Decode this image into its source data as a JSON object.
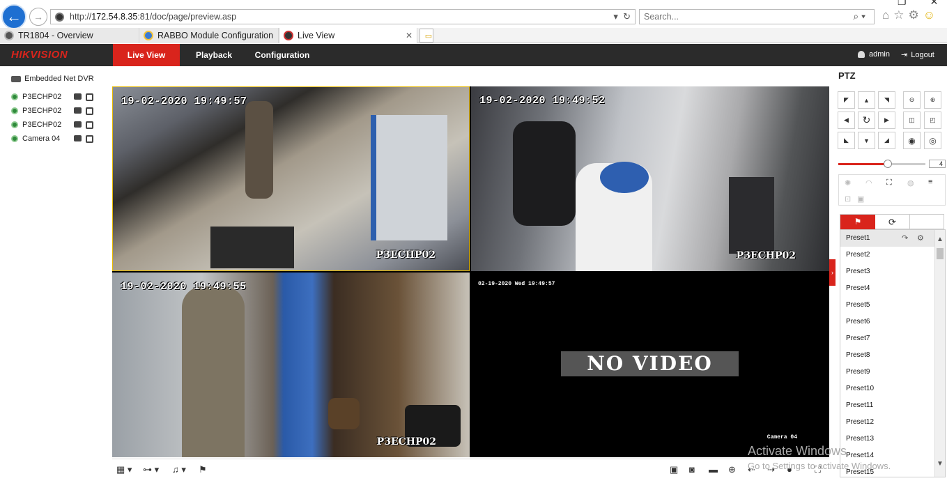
{
  "browser": {
    "url_prefix": "http://",
    "url_host": "172.54.8.35",
    "url_rest": ":81/doc/page/preview.asp",
    "search_placeholder": "Search...",
    "tabs": [
      {
        "label": "TR1804 - Overview"
      },
      {
        "label": "RABBO Module Configuration"
      },
      {
        "label": "Live View"
      }
    ]
  },
  "app": {
    "logo": "HIKVISION",
    "nav": [
      "Live View",
      "Playback",
      "Configuration"
    ],
    "user": "admin",
    "logout": "Logout"
  },
  "tree": {
    "root": "Embedded Net DVR",
    "cameras": [
      {
        "name": "P3ECHP02"
      },
      {
        "name": "P3ECHP02"
      },
      {
        "name": "P3ECHP02"
      },
      {
        "name": "Camera 04"
      }
    ]
  },
  "panes": [
    {
      "timestamp": "19-02-2020 19:49:57",
      "name": "P3ECHP02"
    },
    {
      "timestamp": "19-02-2020 19:49:52",
      "name": "P3ECHP02"
    },
    {
      "timestamp": "19-02-2020 19:49:55",
      "name": "P3ECHP02"
    },
    {
      "timestamp": "02-19-2020 Wed 19:49:57",
      "name": "Camera 04",
      "status": "NO VIDEO"
    }
  ],
  "ptz": {
    "title": "PTZ",
    "speed": 4,
    "speed_max": 7,
    "presets": [
      "Preset1",
      "Preset2",
      "Preset3",
      "Preset4",
      "Preset5",
      "Preset6",
      "Preset7",
      "Preset8",
      "Preset9",
      "Preset10",
      "Preset11",
      "Preset12",
      "Preset13",
      "Preset14",
      "Preset15"
    ]
  },
  "watermark": {
    "title": "Activate Windows",
    "subtitle": "Go to Settings to activate Windows."
  },
  "colors": {
    "brand_red": "#d9241c",
    "header_bg": "#2b2b2b",
    "selected_pane_border": "#e6b800"
  }
}
